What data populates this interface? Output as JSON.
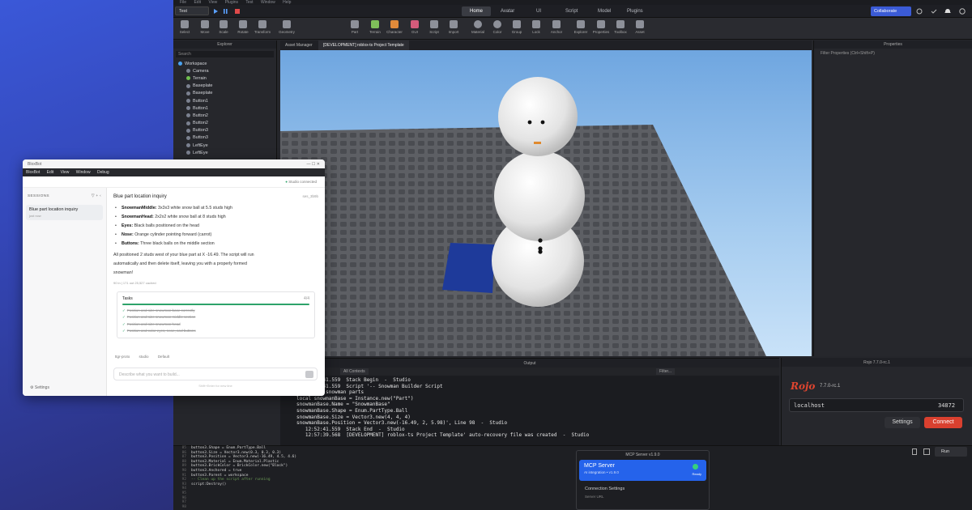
{
  "studio": {
    "menu": [
      "File",
      "Edit",
      "View",
      "Plugins",
      "Test",
      "Window",
      "Help"
    ],
    "place_tab": "Test",
    "header_tabs": [
      "Home",
      "Avatar",
      "UI",
      "Script",
      "Model",
      "Plugins"
    ],
    "active_tab": "Home",
    "collaborate_label": "Collaborate",
    "tools": [
      "Select",
      "Move",
      "Scale",
      "Rotate",
      "Transform",
      "Geometry",
      "Part",
      "Terrain",
      "Character",
      "GUI",
      "Script",
      "Import",
      "Material",
      "Color",
      "Group",
      "Lock",
      "Anchor",
      "Explorer",
      "Properties",
      "Toolbox",
      "Asset"
    ],
    "explorer": {
      "title": "Explorer",
      "search_placeholder": "Search",
      "root": "Workspace",
      "items": [
        "Camera",
        "Terrain",
        "Baseplate",
        "Baseplate",
        "Button1",
        "Button1",
        "Button2",
        "Button2",
        "Button3",
        "Button3",
        "LeftEye",
        "LeftEye"
      ]
    },
    "view_tabs": [
      "Asset Manager",
      "[DEVELOPMENT] roblox-ts Project Template"
    ],
    "properties": {
      "title": "Properties",
      "filter": "Filter Properties (Ctrl+Shift+P)"
    },
    "output": {
      "title": "Output",
      "all_contexts": "All Contexts",
      "filter_placeholder": "Filter...",
      "lines": [
        "   12:52:41.559  Stack Begin  -  Studio",
        "   12:52:41.559  Script '-- Snowman Builder Script",
        "",
        "-- Create snowman parts",
        "local snowmanBase = Instance.new(\"Part\")",
        "snowmanBase.Name = \"SnowmanBase\"",
        "snowmanBase.Shape = Enum.PartType.Ball",
        "snowmanBase.Size = Vector3.new(4, 4, 4)",
        "snowmanBase.Position = Vector3.new(-16.49, 2, 5.98)', Line 98  -  Studio",
        "   12:52:41.559  Stack End  -  Studio",
        "   12:57:39.568  [DEVELOPMENT] roblox-ts Project Template' auto-recovery file was created  -  Studio"
      ]
    },
    "rojo": {
      "title": "Rojo 7.7.0-rc.1",
      "logo": "Rojo",
      "version": "7.7.0-rc.1",
      "host": "localhost",
      "port": "34872",
      "settings_label": "Settings",
      "connect_label": "Connect"
    },
    "script": {
      "line_numbers": [
        "85",
        "86",
        "87",
        "88",
        "89",
        "90",
        "91",
        "92",
        "93",
        "94",
        "95",
        "96",
        "97",
        "98"
      ],
      "lines": [
        "button3.Shape = Enum.PartType.Ball",
        "button3.Size = Vector3.new(0.3, 0.3, 0.3)",
        "button3.Position = Vector3.new(-16.49, 4.5, 4.6)",
        "button3.Material = Enum.Material.Plastic",
        "button3.BrickColor = BrickColor.new(\"Black\")",
        "button3.Anchored = true",
        "button3.Parent = workspace",
        "",
        "-- Clean up the script after running",
        "script:Destroy()",
        "",
        "",
        "",
        ""
      ],
      "run_label": "Run"
    },
    "mcp": {
      "title": "MCP Server v1.9.0",
      "name": "MCP Server",
      "subtitle": "AI integration • v1.9.0",
      "status": "Ready",
      "section": "Connection Settings",
      "field": "Server URL"
    }
  },
  "bloxbot": {
    "title": "BloxBot",
    "menu": [
      "BloxBot",
      "Edit",
      "View",
      "Window",
      "Debug"
    ],
    "status": "Studio connected",
    "sessions_label": "SESSIONS",
    "session_title": "Blue part location inquiry",
    "session_time": "just now",
    "settings_label": "Settings",
    "conversation_title": "Blue part location inquiry",
    "conversation_id": "ses_3b9b",
    "bullets": [
      {
        "bold": "SnowmanMiddle:",
        "text": " 3x3x3 white snow ball at 5.5 studs high"
      },
      {
        "bold": "SnowmanHead:",
        "text": " 2x2x2 white snow ball at 8 studs high"
      },
      {
        "bold": "Eyes:",
        "text": " Black balls positioned on the head"
      },
      {
        "bold": "Nose:",
        "text": " Orange cylinder pointing forward (carrot)"
      },
      {
        "bold": "Buttons:",
        "text": " Three black balls on the middle section"
      }
    ],
    "summary_1": "All positioned 2 studs west of your blue part at X -16.49. The script will run",
    "summary_2": "automatically and then delete itself, leaving you with a properly formed",
    "summary_3": "snowman!",
    "meta": "90 in | 171 out     25,527 cached",
    "tasks_label": "Tasks",
    "tasks_count": "4/4",
    "tasks_progress": 1.0,
    "tasks": [
      "Position and size snowman base correctly",
      "Position and size snowman middle section",
      "Position and size snowman head",
      "Position and color eyes, nose, and buttons"
    ],
    "model_items": [
      "ttgr-proto",
      "studio",
      "Default"
    ],
    "input_placeholder": "Describe what you want to build...",
    "hint": "Shift+Enter for new line"
  }
}
